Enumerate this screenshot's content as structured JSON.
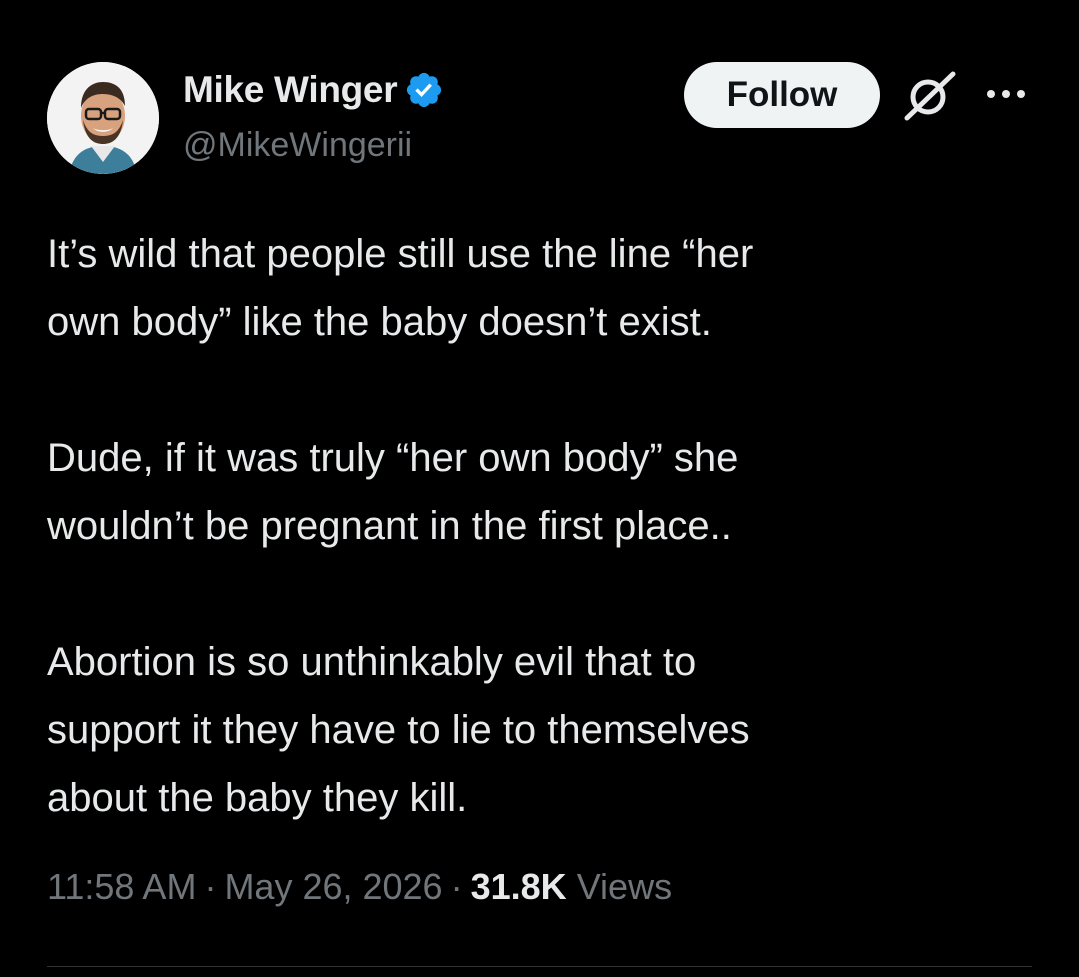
{
  "author": {
    "display_name": "Mike Winger",
    "handle": "@MikeWingerii",
    "verified": true,
    "verified_color": "#1d9bf0",
    "avatar_icon": "profile-photo"
  },
  "actions": {
    "follow_label": "Follow",
    "grok_icon": "grok-icon",
    "more_icon": "more-icon"
  },
  "tweet": {
    "paragraphs": [
      "It’s wild that people still use the line “her\nown body” like the baby doesn’t exist.",
      "Dude, if it was truly  “her own body” she\nwouldn’t be pregnant in the first place..",
      "Abortion is so unthinkably evil that to\nsupport it they have to lie to themselves\nabout the baby they kill."
    ]
  },
  "meta": {
    "time": "11:58 AM",
    "separator": "·",
    "date": "May 26, 2026",
    "views_count": "31.8K",
    "views_label": "Views"
  }
}
